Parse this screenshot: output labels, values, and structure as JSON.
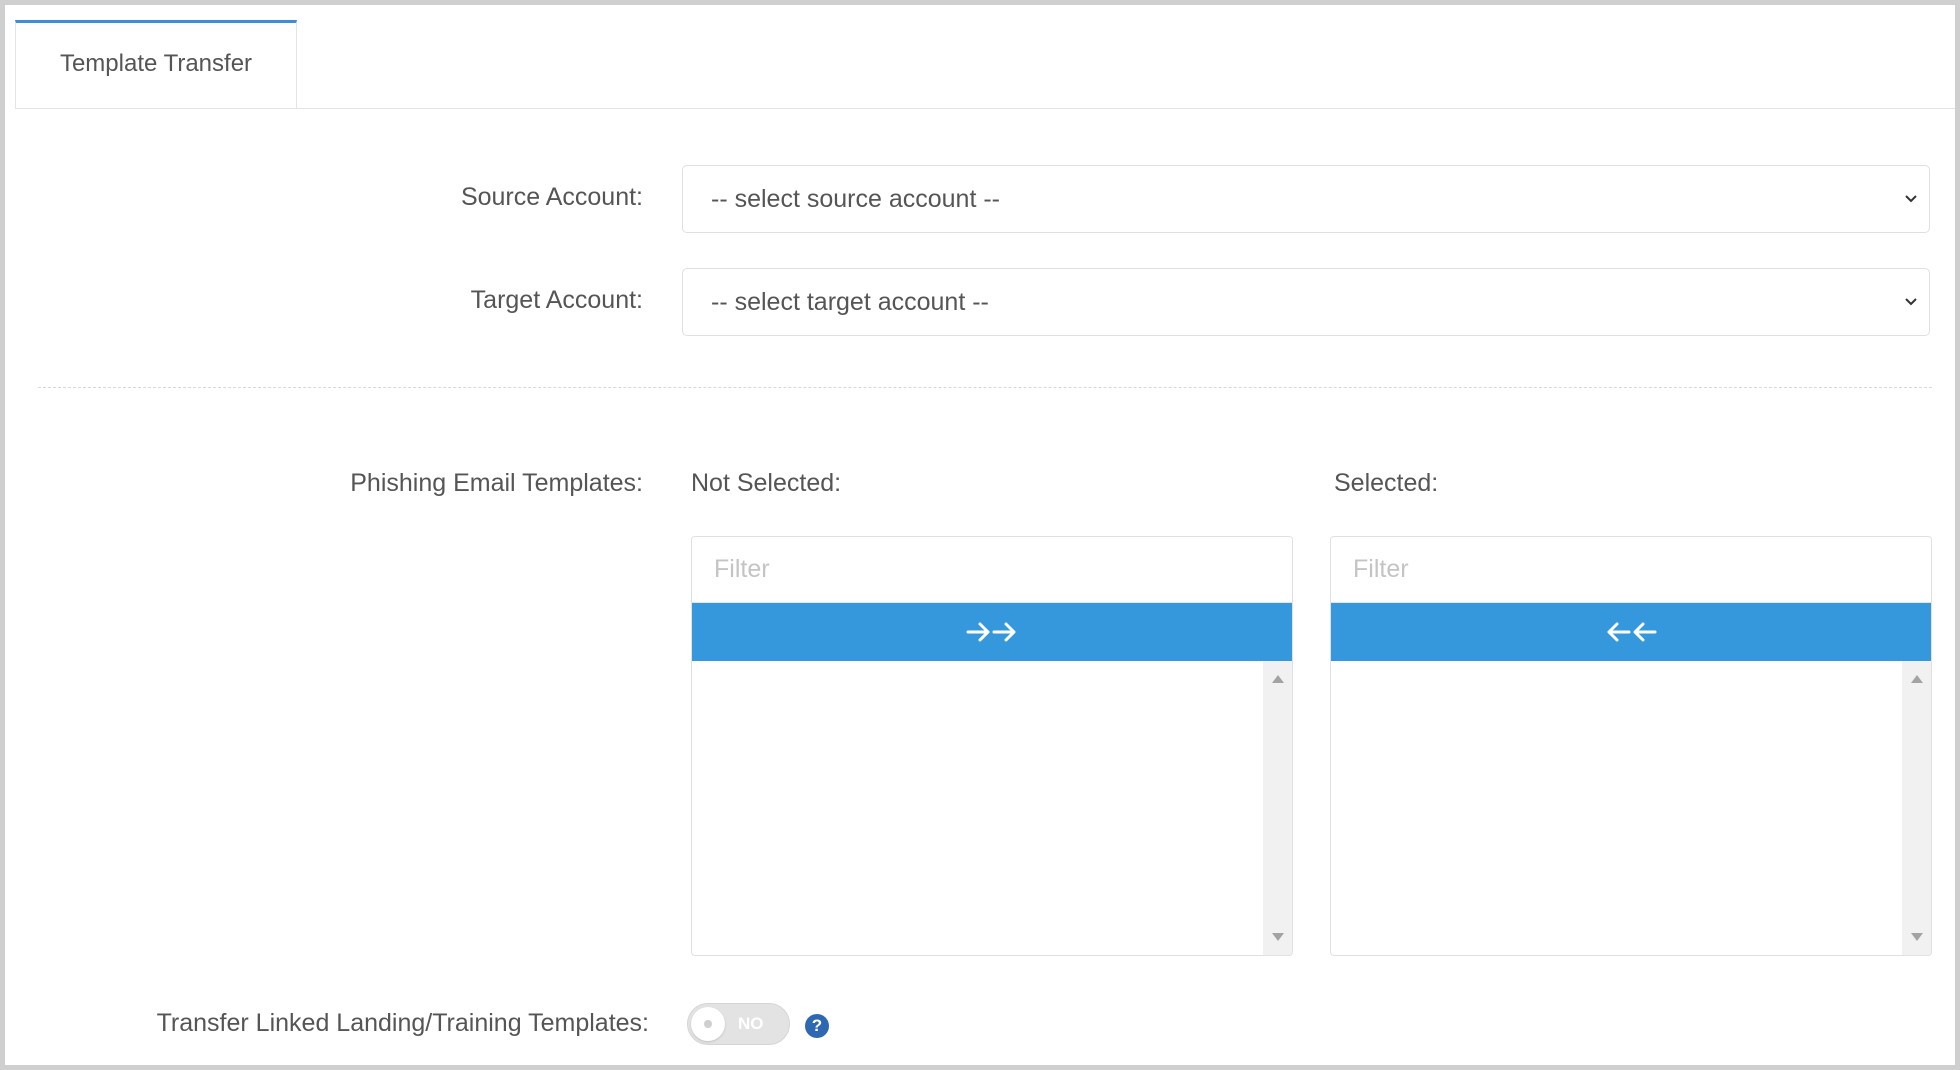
{
  "tabs": [
    {
      "label": "Template Transfer",
      "active": true
    }
  ],
  "form": {
    "source_account": {
      "label": "Source Account:",
      "selected": "-- select source account --"
    },
    "target_account": {
      "label": "Target Account:",
      "selected": "-- select target account --"
    },
    "phishing_templates": {
      "label": "Phishing Email Templates:",
      "not_selected": {
        "heading": "Not Selected:",
        "filter_placeholder": "Filter",
        "filter_value": "",
        "move_button_icon": "double-arrow-right-icon",
        "items": []
      },
      "selected": {
        "heading": "Selected:",
        "filter_placeholder": "Filter",
        "filter_value": "",
        "move_button_icon": "double-arrow-left-icon",
        "items": []
      }
    },
    "transfer_linked": {
      "label": "Transfer Linked Landing/Training Templates:",
      "toggle_state": "NO",
      "help_icon": "question-mark-icon",
      "help_glyph": "?"
    }
  },
  "colors": {
    "accent": "#3598dc",
    "tab_border": "#3a8fd6",
    "help_badge": "#2f68b2",
    "text": "#555555"
  }
}
